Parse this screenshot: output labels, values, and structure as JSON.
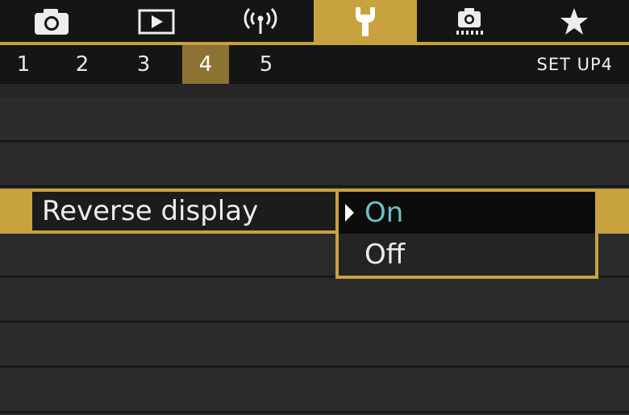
{
  "tabs": [
    {
      "icon": "camera-icon",
      "active": false
    },
    {
      "icon": "playback-icon",
      "active": false
    },
    {
      "icon": "wireless-icon",
      "active": false
    },
    {
      "icon": "wrench-icon",
      "active": true
    },
    {
      "icon": "custom-functions-icon",
      "active": false
    },
    {
      "icon": "star-icon",
      "active": false
    }
  ],
  "subtabs": [
    "1",
    "2",
    "3",
    "4",
    "5"
  ],
  "active_subtab": "4",
  "menu_page_label": "SET UP4",
  "selected_item": {
    "label": "Reverse display"
  },
  "options": [
    {
      "label": "On",
      "selected": true
    },
    {
      "label": "Off",
      "selected": false
    }
  ],
  "colors": {
    "accent_gold": "#c8a23e",
    "active_subtab": "#8c7334",
    "selected_value": "#6ec1c3",
    "background": "#2b2b2b"
  }
}
